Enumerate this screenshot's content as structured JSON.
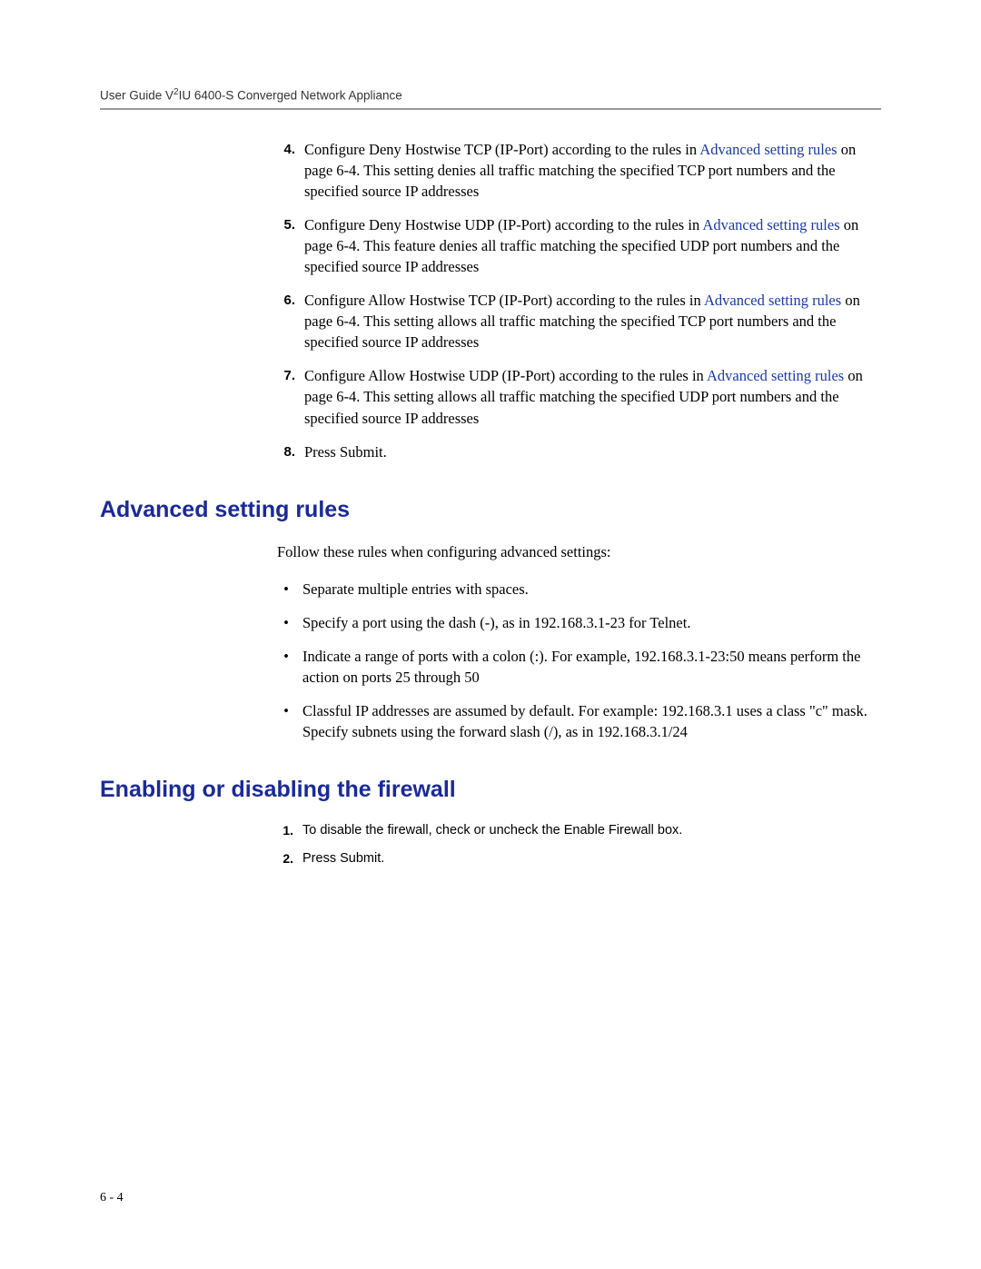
{
  "header": {
    "prefix": "User Guide V",
    "sup": "2",
    "suffix": "IU 6400-S Converged Network Appliance"
  },
  "numbered_steps": [
    {
      "num": "4.",
      "before": "Configure Deny Hostwise TCP (IP-Port) according to the rules in ",
      "link": "Advanced setting rules",
      "after": " on page 6-4. This setting denies all traffic matching the specified TCP port numbers and the specified source IP addresses"
    },
    {
      "num": "5.",
      "before": "Configure Deny Hostwise UDP (IP-Port) according to the rules in ",
      "link": "Advanced setting rules",
      "after": " on page 6-4. This feature denies all traffic matching the specified UDP port numbers and the specified source IP addresses"
    },
    {
      "num": "6.",
      "before": "Configure Allow Hostwise TCP (IP-Port) according to the rules in ",
      "link": "Advanced setting rules",
      "after": " on page 6-4. This setting allows all traffic matching the specified TCP port numbers and the specified source IP addresses"
    },
    {
      "num": "7.",
      "before": "Configure Allow Hostwise UDP (IP-Port) according to the rules in ",
      "link": "Advanced setting rules",
      "after": " on page 6-4. This setting allows all traffic matching the specified UDP port numbers and the specified source IP addresses"
    },
    {
      "num": "8.",
      "before": "Press Submit.",
      "link": "",
      "after": ""
    }
  ],
  "section1": {
    "heading": "Advanced setting rules",
    "intro": "Follow these rules when configuring advanced settings:",
    "bullets": [
      "Separate multiple entries with spaces.",
      "Specify a port using the dash (-), as in 192.168.3.1-23 for Telnet.",
      "Indicate a range of ports with a colon (:). For example, 192.168.3.1-23:50 means perform the action on ports 25 through 50",
      "Classful IP addresses are assumed by default. For example: 192.168.3.1 uses a class \"c\" mask. Specify subnets using the forward slash (/), as in 192.168.3.1/24"
    ]
  },
  "section2": {
    "heading": "Enabling or disabling the firewall",
    "steps": [
      {
        "num": "1.",
        "text": "To disable the firewall, check or uncheck the Enable Firewall box."
      },
      {
        "num": "2.",
        "text": "Press Submit."
      }
    ]
  },
  "footer": "6 - 4"
}
